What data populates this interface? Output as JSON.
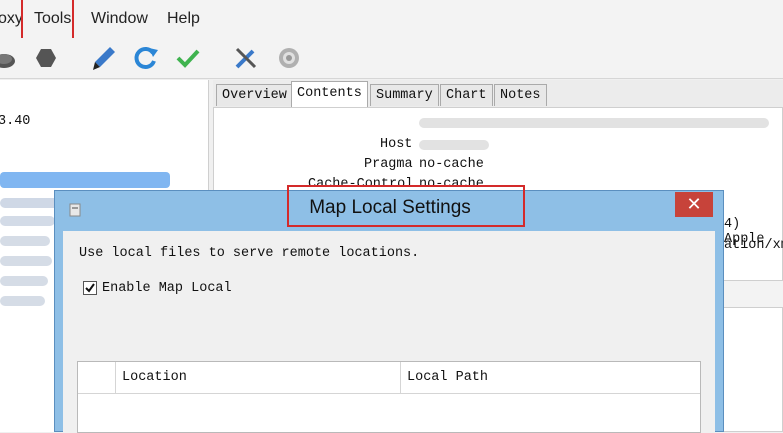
{
  "menu": {
    "items": [
      "oxy",
      "Tools",
      "Window",
      "Help"
    ]
  },
  "toolbar": {
    "icons": [
      "turtle-icon",
      "stop-hexagon-icon",
      "pen-icon",
      "refresh-icon",
      "check-icon",
      "tools-icon",
      "gear-icon"
    ]
  },
  "left_pane": {
    "line1": "3.40"
  },
  "tabs": [
    "Overview",
    "Contents",
    "Summary",
    "Chart",
    "Notes"
  ],
  "headers": {
    "host_key": "Host",
    "pragma_key": "Pragma",
    "pragma_val": "no-cache",
    "cache_key": "Cache-Control",
    "cache_val": "no-cache",
    "right_frag1": "4) Apple",
    "right_frag2": "ation/xm"
  },
  "dialog": {
    "title": "Map Local Settings",
    "close": "✕",
    "description": "Use local files to serve remote locations.",
    "enable_label": "Enable Map Local",
    "enable_checked": true,
    "columns": [
      "Location",
      "Local Path"
    ]
  }
}
